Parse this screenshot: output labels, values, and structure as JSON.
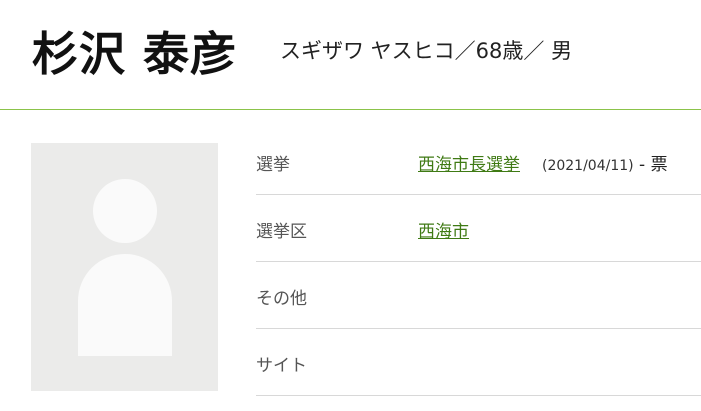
{
  "candidate": {
    "name": "杉沢 泰彦",
    "subtitle": "スギザワ ヤスヒコ／68歳／ 男"
  },
  "accent_color": "#8bc34a",
  "link_color": "#3f7a14",
  "photo": {
    "icon": "person-placeholder-icon"
  },
  "rows": [
    {
      "label": "選挙",
      "link": "西海市長選挙",
      "date": "(2021/04/11)",
      "votes": " - 票"
    },
    {
      "label": "選挙区",
      "link": "西海市"
    },
    {
      "label": "その他",
      "value": ""
    },
    {
      "label": "サイト",
      "value": ""
    }
  ]
}
